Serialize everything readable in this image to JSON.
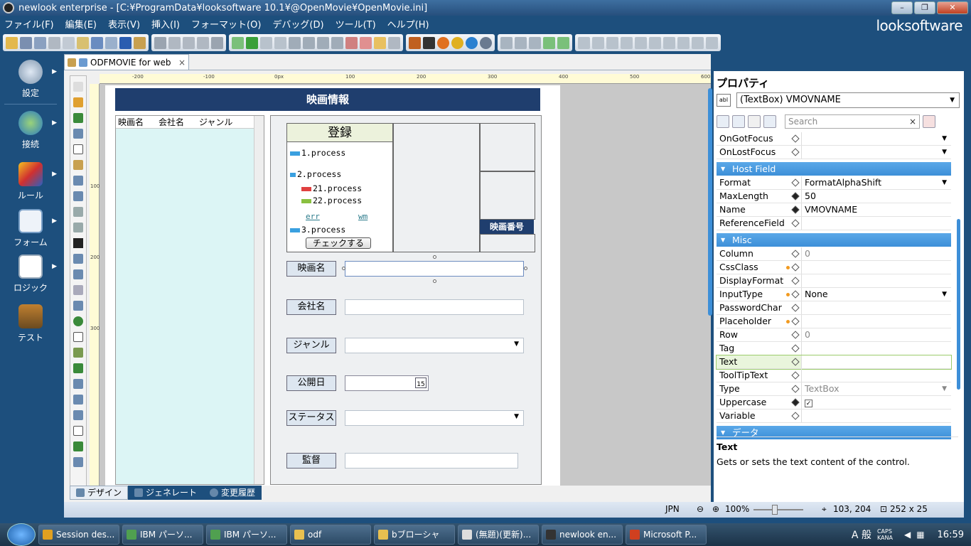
{
  "window": {
    "title": "newlook enterprise - [C:¥ProgramData¥looksoftware 10.1¥@OpenMovie¥OpenMovie.ini]",
    "minimize": "–",
    "maximize": "❐",
    "close": "✕"
  },
  "menu": [
    "ファイル(F)",
    "編集(E)",
    "表示(V)",
    "挿入(I)",
    "フォーマット(O)",
    "デバッグ(D)",
    "ツール(T)",
    "ヘルプ(H)"
  ],
  "brand": "looksoftware",
  "leftnav": [
    {
      "label": "設定",
      "icon": "gear-icon",
      "color": "#9cb6d0"
    },
    {
      "label": "接続",
      "icon": "globe-icon",
      "color": "#5ab04c"
    },
    {
      "label": "ルール",
      "icon": "cube-icon",
      "color": "#e8a020"
    },
    {
      "label": "フォーム",
      "icon": "form-icon",
      "color": "#dfe8f3"
    },
    {
      "label": "ロジック",
      "icon": "logic-icon",
      "color": "#e8c23a"
    },
    {
      "label": "テスト",
      "icon": "stamp-icon",
      "color": "#c08030"
    }
  ],
  "doc": {
    "tab_label": "ODFMOVIE for web",
    "tab_close": "×",
    "ruler_h": [
      "-200",
      "-100",
      "0px",
      "100",
      "200",
      "300",
      "400",
      "500",
      "600"
    ],
    "ruler_v": [
      "100",
      "200",
      "300"
    ],
    "form_title": "映画情報",
    "list_headers": [
      "映画名",
      "会社名",
      "ジャンル"
    ],
    "register_title": "登録",
    "processes": {
      "p1": "1.process",
      "p2": "2.process",
      "p21": "21.process",
      "p22": "22.process",
      "p3": "3.process"
    },
    "links": {
      "err": "err",
      "wm": "wm"
    },
    "check_button": "チェックする",
    "movie_number": "映画番号",
    "fields": {
      "movie_name": "映画名",
      "company": "会社名",
      "genre": "ジャンル",
      "release_date": "公開日",
      "status": "ステータス",
      "director": "監督"
    },
    "calendar_day": "15",
    "bottom_tabs": [
      "デザイン",
      "ジェネレート",
      "変更履歴"
    ]
  },
  "props": {
    "title": "プロパティ",
    "selected_object": "(TextBox) VMOVNAME",
    "search_placeholder": "Search",
    "search_clear": "×",
    "rows_top": [
      {
        "name": "OnGotFocus",
        "value": "",
        "dd": true
      },
      {
        "name": "OnLostFocus",
        "value": "",
        "dd": true
      }
    ],
    "cat_host": "Host Field",
    "rows_host": [
      {
        "name": "Format",
        "value": "FormatAlphaShift",
        "dd": true,
        "filled": false
      },
      {
        "name": "MaxLength",
        "value": "50",
        "filled": true
      },
      {
        "name": "Name",
        "value": "VMOVNAME",
        "filled": true
      },
      {
        "name": "ReferenceField",
        "value": ""
      }
    ],
    "cat_misc": "Misc",
    "rows_misc": [
      {
        "name": "Column",
        "value": "0",
        "grey": true
      },
      {
        "name": "CssClass",
        "value": "",
        "dot": true
      },
      {
        "name": "DisplayFormat",
        "value": ""
      },
      {
        "name": "InputType",
        "value": "None",
        "dot": true,
        "dd": true
      },
      {
        "name": "PasswordChar",
        "value": ""
      },
      {
        "name": "Placeholder",
        "value": "",
        "dot": true
      },
      {
        "name": "Row",
        "value": "0",
        "grey": true
      },
      {
        "name": "Tag",
        "value": ""
      },
      {
        "name": "Text",
        "value": "",
        "highlight": true
      },
      {
        "name": "ToolTipText",
        "value": ""
      },
      {
        "name": "Type",
        "value": "TextBox",
        "grey": true,
        "dd": true
      },
      {
        "name": "Uppercase",
        "value": "✓",
        "filled": true,
        "check": true
      },
      {
        "name": "Variable",
        "value": ""
      }
    ],
    "cat_data": "データ",
    "desc_title": "Text",
    "desc_text": "Gets or sets the text content of the control."
  },
  "status": {
    "lang": "JPN",
    "zoom": "100%",
    "position": "103, 204",
    "size": "252 x 25"
  },
  "taskbar": {
    "tasks": [
      {
        "label": "Session des...",
        "color": "#e0a020"
      },
      {
        "label": "IBM パーソ...",
        "color": "#50a050"
      },
      {
        "label": "IBM パーソ...",
        "color": "#50a050"
      },
      {
        "label": "odf",
        "color": "#e8c050"
      },
      {
        "label": "bブローシャ",
        "color": "#e8c050"
      },
      {
        "label": "(無題)(更新)...",
        "color": "#ddd"
      },
      {
        "label": "newlook en...",
        "color": "#333"
      },
      {
        "label": "Microsoft P...",
        "color": "#d04020"
      }
    ],
    "ime": "A 般",
    "caps": "CAPS KANA",
    "time": "16:59"
  }
}
